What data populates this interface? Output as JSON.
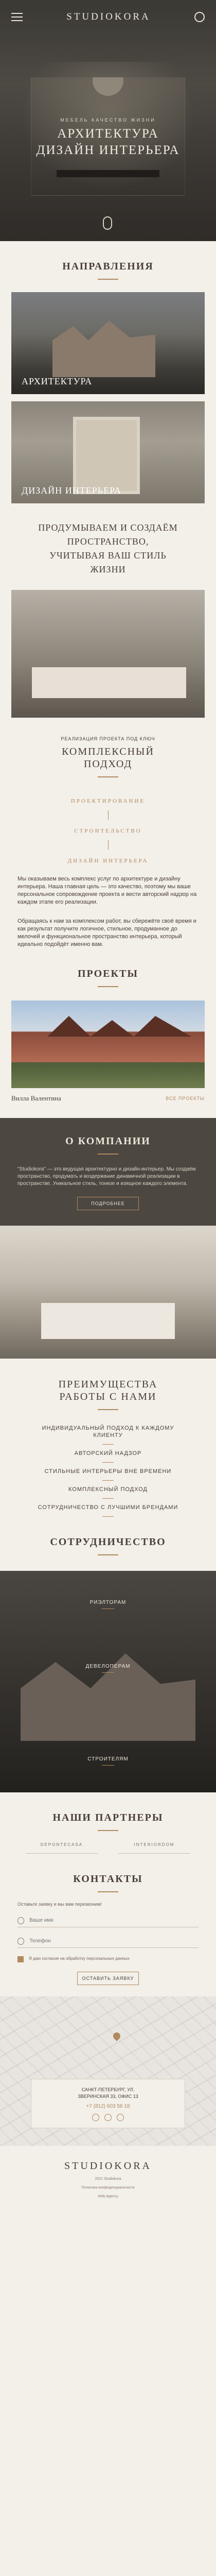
{
  "hero": {
    "logo": "STUDIOKORA",
    "subtitle": "МЕБЕЛЬ  КАЧЕСТВО  ЖИЗНИ",
    "title_line1": "АРХИТЕКТУРА",
    "title_line2": "ДИЗАЙН ИНТЕРЬЕРА"
  },
  "directions": {
    "title": "НАПРАВЛЕНИЯ",
    "items": [
      {
        "label": "АРХИТЕКТУРА"
      },
      {
        "label": "ДИЗАЙН ИНТЕРЬЕРА"
      }
    ]
  },
  "tagline": {
    "line1": "ПРОДУМЫВАЕМ И СОЗДАЁМ",
    "line2": "ПРОСТРАНСТВО,",
    "line3": "УЧИТЫВАЯ ВАШ СТИЛЬ",
    "line4": "ЖИЗНИ"
  },
  "complex": {
    "kicker": "РЕАЛИЗАЦИЯ ПРОЕКТА ПОД КЛЮЧ",
    "title_line1": "КОМПЛЕКСНЫЙ",
    "title_line2": "ПОДХОД",
    "steps": [
      "ПРОЕКТИРОВАНИЕ",
      "СТРОИТЕЛЬСТВО",
      "ДИЗАЙН ИНТЕРЬЕРА"
    ],
    "para1": "Мы оказываем весь комплекс услуг по архитектуре и дизайну интерьера. Наша главная цель — это качество, поэтому мы ваше персональное сопровождение проекта и вести авторский надзор на каждом этапе его реализации.",
    "para2": "Обращаясь к нам за комплексом работ, вы сбережёте своё время и как результат получите логичное, стильное, продуманное до мелочей и функциональное пространство интерьера, который идеально подойдёт именно вам."
  },
  "projects": {
    "title": "ПРОЕКТЫ",
    "name": "Вилла Валентина",
    "link": "ВСЕ ПРОЕКТЫ"
  },
  "about": {
    "title": "О КОМПАНИИ",
    "text": "\"Studiokora\" — это ведущая архитектурно и дизайн-интерьер. Мы создаём пространство, продумать и воздержание динамичной реализации в пространстве. Уникальное стиль, тонкое и изящное каждого элемента.",
    "button": "ПОДРОБНЕЕ"
  },
  "advantages": {
    "title_line1": "ПРЕИМУЩЕСТВА",
    "title_line2": "РАБОТЫ С НАМИ",
    "items": [
      "ИНДИВИДУАЛЬНЫЙ ПОДХОД К КАЖДОМУ КЛИЕНТУ",
      "АВТОРСКИЙ НАДЗОР",
      "СТИЛЬНЫЕ ИНТЕРЬЕРЫ ВНЕ ВРЕМЕНИ",
      "КОМПЛЕКСНЫЙ ПОДХОД",
      "СОТРУДНИЧЕСТВО С ЛУЧШИМИ БРЕНДАМИ"
    ]
  },
  "team": {
    "title": "СОТРУДНИЧЕСТВО",
    "roles": [
      "РИЭЛТОРАМ",
      "ДЕВЕЛОПЕРАМ",
      "СТРОИТЕЛЯМ"
    ]
  },
  "partners": {
    "title": "НАШИ ПАРТНЕРЫ",
    "items": [
      "DEPONTECASA",
      "INTERIORDOM"
    ]
  },
  "contacts": {
    "title": "КОНТАКТЫ",
    "text": "Оставьте заявку и мы вам перезвоним!",
    "name_placeholder": "Ваше имя",
    "phone_placeholder": "Телефон",
    "agree": "Я даю согласие на обработку персональных данных",
    "button": "ОСТАВИТЬ ЗАЯВКУ",
    "address_line1": "САНКТ-ПЕТЕРБУРГ, УЛ.",
    "address_line2": "ЗВЕРИНСКАЯ 33, ОФИС 13",
    "phone": "+7 (812) 603 58 18"
  },
  "footer": {
    "logo": "STUDIOKORA",
    "line1": "2021 Studiokora",
    "line2": "Политика конфиденциальности",
    "line3": "Web Agency"
  }
}
